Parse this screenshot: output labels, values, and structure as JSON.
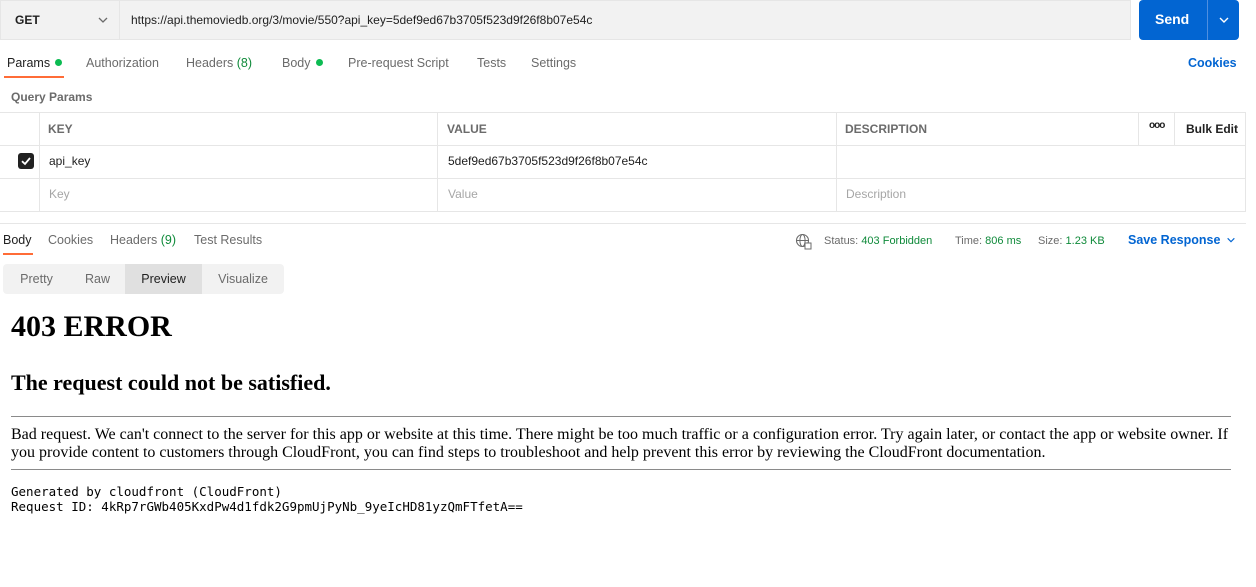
{
  "request": {
    "method": "GET",
    "url": "https://api.themoviedb.org/3/movie/550?api_key=5def9ed67b3705f523d9f26f8b07e54c",
    "send_label": "Send"
  },
  "request_tabs": {
    "params": "Params",
    "authorization": "Authorization",
    "headers": "Headers",
    "headers_count": "(8)",
    "body": "Body",
    "pre_request": "Pre-request Script",
    "tests": "Tests",
    "settings": "Settings",
    "cookies": "Cookies"
  },
  "query_params": {
    "title": "Query Params",
    "columns": {
      "key": "KEY",
      "value": "VALUE",
      "description": "DESCRIPTION",
      "more": "ooo",
      "bulk_edit": "Bulk Edit"
    },
    "rows": [
      {
        "checked": true,
        "key": "api_key",
        "value": "5def9ed67b3705f523d9f26f8b07e54c",
        "description": ""
      }
    ],
    "placeholders": {
      "key": "Key",
      "value": "Value",
      "description": "Description"
    }
  },
  "response_tabs": {
    "body": "Body",
    "cookies": "Cookies",
    "headers": "Headers",
    "headers_count": "(9)",
    "test_results": "Test Results"
  },
  "response_meta": {
    "status_label": "Status:",
    "status_value": "403 Forbidden",
    "time_label": "Time:",
    "time_value": "806 ms",
    "size_label": "Size:",
    "size_value": "1.23 KB",
    "save_response": "Save Response"
  },
  "view_modes": {
    "pretty": "Pretty",
    "raw": "Raw",
    "preview": "Preview",
    "visualize": "Visualize",
    "active": "Preview"
  },
  "preview": {
    "heading": "403 ERROR",
    "subheading": "The request could not be satisfied.",
    "paragraph": "Bad request. We can't connect to the server for this app or website at this time. There might be too much traffic or a configuration error. Try again later, or contact the app or website owner. If you provide content to customers through CloudFront, you can find steps to troubleshoot and help prevent this error by reviewing the CloudFront documentation.",
    "generated_by": "Generated by cloudfront (CloudFront)",
    "request_id": "Request ID: 4kRp7rGWb405KxdPw4d1fdk2G9pmUjPyNb_9yeIcHD81yzQmFTfetA=="
  },
  "colors": {
    "accent_orange": "#ff6c37",
    "send_blue": "#0265d2",
    "status_green": "#0f8a3a",
    "dot_green": "#0cbb52"
  }
}
